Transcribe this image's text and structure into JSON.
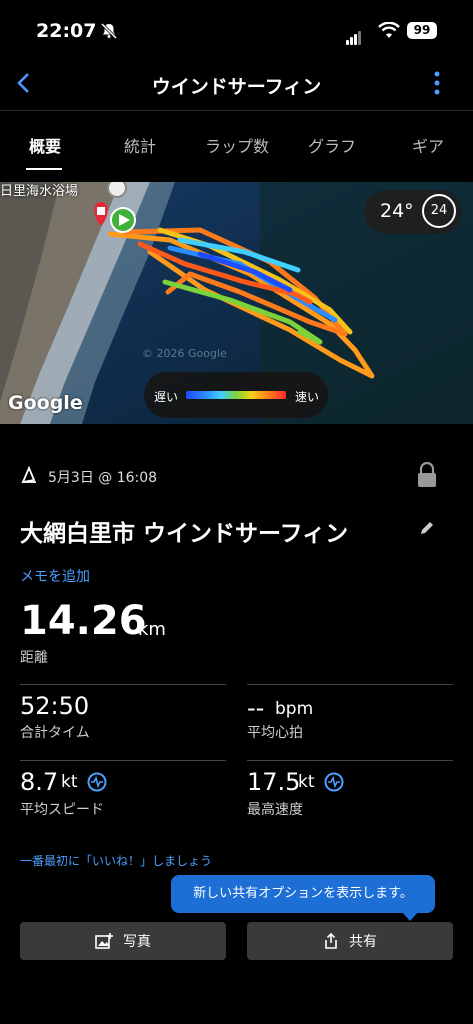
{
  "status": {
    "time": "22:07",
    "battery": "99"
  },
  "nav": {
    "title": "ウインドサーフィン"
  },
  "tabs": [
    {
      "label": "概要",
      "active": true
    },
    {
      "label": "統計"
    },
    {
      "label": "ラップ数"
    },
    {
      "label": "グラフ"
    },
    {
      "label": "ギア"
    }
  ],
  "map": {
    "place_label": "日里海水浴場",
    "temperature": "24°",
    "uv_index": "24",
    "legend_slow": "遅い",
    "legend_fast": "速い",
    "attribution": "Google",
    "watermark": "© 2026 Google"
  },
  "activity": {
    "date": "5月3日 @ 16:08",
    "name": "大網白里市 ウインドサーフィン",
    "memo_link": "メモを追加"
  },
  "stats": {
    "distance_value": "14.26",
    "distance_unit": "km",
    "distance_label": "距離",
    "time_value": "52:50",
    "time_label": "合計タイム",
    "hr_value": "--",
    "hr_unit": "bpm",
    "hr_label": "平均心拍",
    "avg_speed_value": "8.7",
    "avg_speed_unit": "kt",
    "avg_speed_label": "平均スピード",
    "max_speed_value": "17.5",
    "max_speed_unit": "kt",
    "max_speed_label": "最高速度"
  },
  "social": {
    "like_prompt": "一番最初に「いいね！」しましょう",
    "tooltip": "新しい共有オプションを表示します。",
    "photo_button": "写真",
    "share_button": "共有"
  },
  "colors": {
    "accent": "#4a9fff",
    "tooltip_bg": "#1d6fd6"
  }
}
